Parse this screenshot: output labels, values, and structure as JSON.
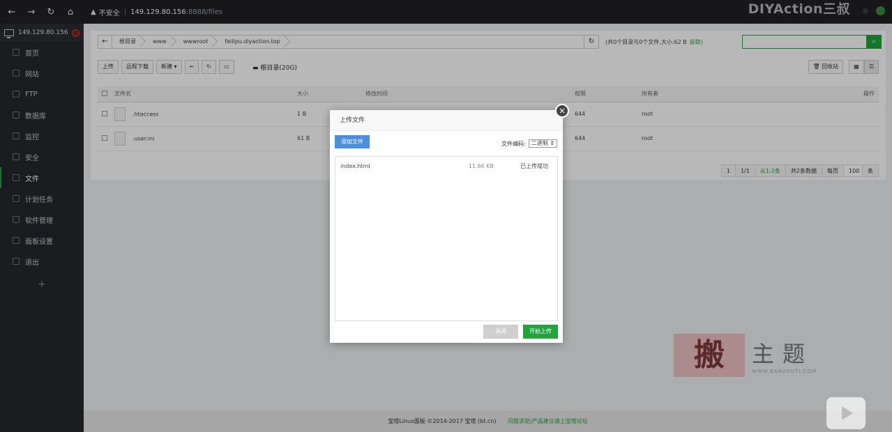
{
  "browser": {
    "security": "不安全",
    "host": "149.129.80.156",
    "path": ":8888/files",
    "watermark_brand": "DIYAction三叔"
  },
  "sidebar": {
    "server": "149.129.80.156",
    "items": [
      {
        "label": "首页",
        "icon": "home-icon"
      },
      {
        "label": "网站",
        "icon": "globe-icon"
      },
      {
        "label": "FTP",
        "icon": "ftp-icon"
      },
      {
        "label": "数据库",
        "icon": "database-icon"
      },
      {
        "label": "监控",
        "icon": "monitor-icon"
      },
      {
        "label": "安全",
        "icon": "shield-icon"
      },
      {
        "label": "文件",
        "icon": "folder-icon"
      },
      {
        "label": "计划任务",
        "icon": "calendar-icon"
      },
      {
        "label": "软件管理",
        "icon": "grid-icon"
      },
      {
        "label": "面板设置",
        "icon": "gear-icon"
      },
      {
        "label": "退出",
        "icon": "logout-icon"
      }
    ],
    "active_index": 6,
    "add_label": "+"
  },
  "files": {
    "breadcrumbs": [
      "根目录",
      "www",
      "wwwroot",
      "feilipu.diyaction.top"
    ],
    "dir_info": "(共0个目录与0个文件,大小:62 B",
    "dir_info_link": "获取)",
    "toolbar": {
      "upload": "上传",
      "remote_download": "远程下载",
      "new": "新建 ▾"
    },
    "disk_label": "根目录(20G)",
    "recycle": "回收站",
    "columns": [
      "文件名",
      "大小",
      "修改时间",
      "权限",
      "所有者",
      "操作"
    ],
    "rows": [
      {
        "name": ".htaccess",
        "size": "1 B",
        "perm": "644",
        "owner": "root"
      },
      {
        "name": ".user.ini",
        "size": "61 B",
        "perm": "644",
        "owner": "root"
      }
    ],
    "pager": {
      "page": "1",
      "pages": "1/1",
      "range": "从1-2条",
      "total": "共2条数据",
      "per_page_label": "每页",
      "per_page": "100",
      "unit": "条"
    }
  },
  "footer": {
    "copyright": "宝塔Linux面板 ©2014-2017 宝塔 (bt.cn)",
    "link": "问题求助|产品建议请上宝塔论坛"
  },
  "dialog": {
    "title": "上传文件",
    "add_file": "添加文件",
    "encoding_label": "文件编码:",
    "encoding_value": "二进制",
    "files": [
      {
        "name": "index.html",
        "size": "11.66 KB",
        "status": "已上传成功"
      }
    ],
    "close_label": "关闭",
    "start_label": "开始上传"
  },
  "watermark": {
    "stamp": "搬",
    "cn": "主题",
    "en": "WWW.BANZHUTI.COM"
  }
}
